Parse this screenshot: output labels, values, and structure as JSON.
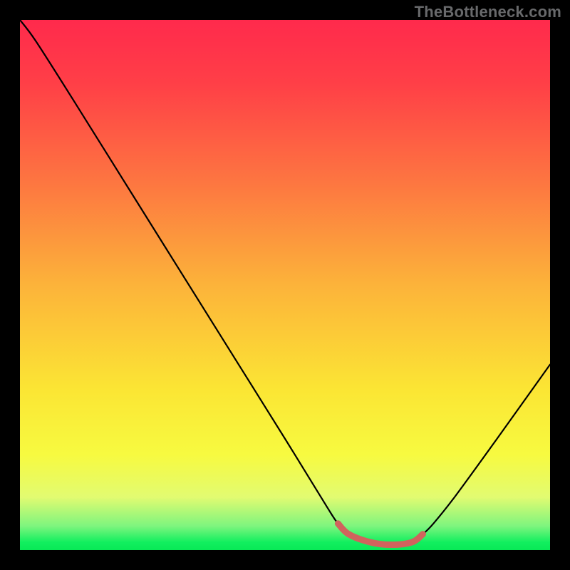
{
  "watermark": "TheBottleneck.com",
  "chart_data": {
    "type": "line",
    "title": "",
    "xlabel": "",
    "ylabel": "",
    "xlim": [
      0,
      100
    ],
    "ylim": [
      0,
      100
    ],
    "grid": false,
    "series": [
      {
        "name": "curve",
        "x": [
          0,
          3,
          10,
          20,
          30,
          40,
          50,
          58,
          60,
          62,
          66,
          70,
          74,
          76,
          78,
          82,
          90,
          100
        ],
        "values": [
          100,
          96,
          85,
          69,
          53,
          37,
          21,
          8,
          5,
          3,
          1.5,
          1,
          1.5,
          3,
          5,
          10,
          21,
          35
        ]
      }
    ],
    "trough_highlight": {
      "x_start": 60,
      "x_end": 76,
      "y": 2,
      "color": "#d0635d"
    },
    "gradient_stops": [
      {
        "offset": 0.0,
        "color": "#ff2a4c"
      },
      {
        "offset": 0.12,
        "color": "#ff3f47"
      },
      {
        "offset": 0.3,
        "color": "#fd7441"
      },
      {
        "offset": 0.5,
        "color": "#fcb33a"
      },
      {
        "offset": 0.7,
        "color": "#fbe634"
      },
      {
        "offset": 0.82,
        "color": "#f7fa40"
      },
      {
        "offset": 0.9,
        "color": "#e2fb71"
      },
      {
        "offset": 0.955,
        "color": "#7df57e"
      },
      {
        "offset": 0.985,
        "color": "#12ef5f"
      },
      {
        "offset": 1.0,
        "color": "#08e956"
      }
    ]
  }
}
